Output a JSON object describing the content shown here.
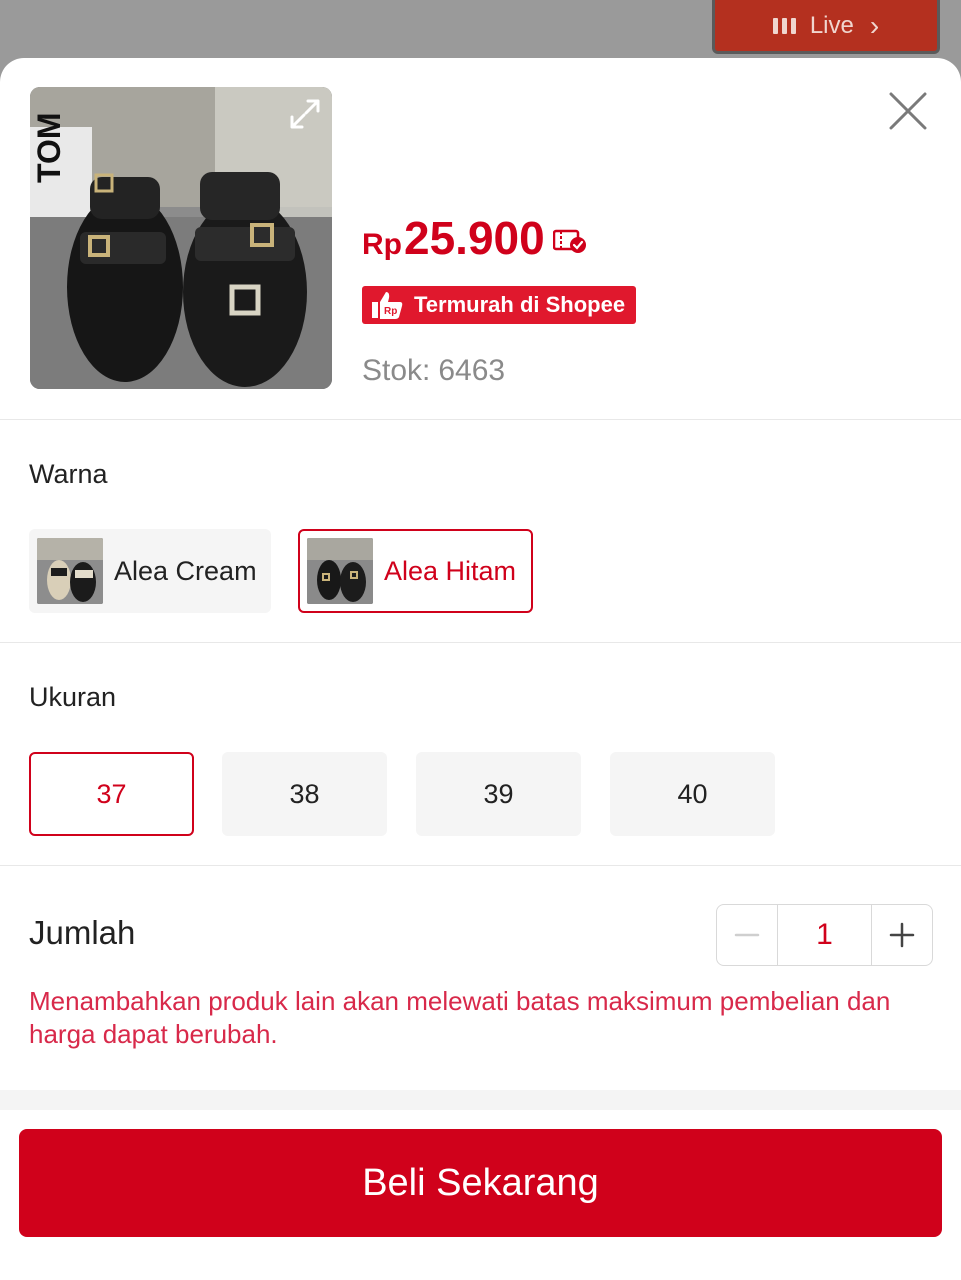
{
  "live": {
    "label": "Live"
  },
  "product": {
    "price_currency": "Rp",
    "price_amount": "25.900",
    "badge_text": "Termurah di Shopee",
    "stock_label": "Stok:",
    "stock_value": "6463"
  },
  "variants": {
    "label": "Warna",
    "options": [
      {
        "label": "Alea Cream",
        "selected": false
      },
      {
        "label": "Alea Hitam",
        "selected": true
      }
    ]
  },
  "sizes": {
    "label": "Ukuran",
    "options": [
      "37",
      "38",
      "39",
      "40"
    ],
    "selected": "37"
  },
  "quantity": {
    "label": "Jumlah",
    "value": "1",
    "warning": "Menambahkan produk lain akan melewati batas maksimum pembelian dan harga dapat berubah."
  },
  "cta": {
    "label": "Beli Sekarang"
  },
  "colors": {
    "brand": "#d0011b",
    "badge": "#e0182d",
    "live": "#b4301f"
  }
}
